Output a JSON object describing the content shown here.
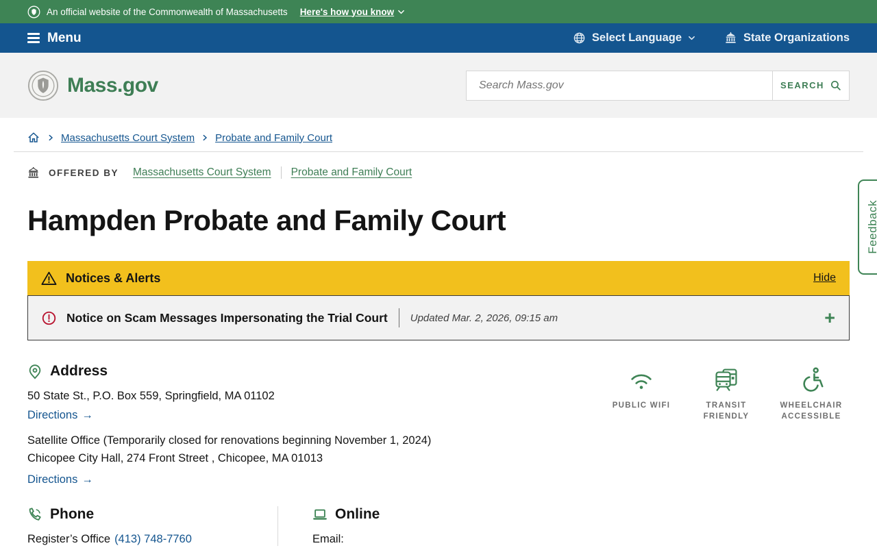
{
  "banner": {
    "text": "An official website of the Commonwealth of Massachusetts",
    "how_you_know": "Here's how you know"
  },
  "nav": {
    "menu_label": "Menu",
    "select_language": "Select Language",
    "state_organizations": "State Organizations"
  },
  "header": {
    "logo_text": "Mass.gov",
    "search_placeholder": "Search Mass.gov",
    "search_button": "SEARCH"
  },
  "breadcrumb": {
    "items": [
      "Massachusetts Court System",
      "Probate and Family Court"
    ]
  },
  "offered_by": {
    "label": "OFFERED BY",
    "links": [
      "Massachusetts Court System",
      "Probate and Family Court"
    ]
  },
  "page_title": "Hampden Probate and Family Court",
  "alerts": {
    "header": "Notices & Alerts",
    "hide_label": "Hide",
    "notice_title": "Notice on Scam Messages Impersonating the Trial Court",
    "notice_updated": "Updated Mar. 2, 2026, 09:15 am",
    "expand_symbol": "+"
  },
  "address": {
    "heading": "Address",
    "main_address": "50 State St., P.O. Box 559, Springfield, MA 01102",
    "directions_label": "Directions",
    "directions_arrow": "→",
    "satellite_title": "Satellite Office (Temporarily closed for renovations beginning November 1, 2024)",
    "satellite_address": "Chicopee City Hall, 274 Front Street , Chicopee, MA 01013"
  },
  "amenities": [
    {
      "name": "public-wifi",
      "label": "PUBLIC WIFI"
    },
    {
      "name": "transit-friendly",
      "label": "TRANSIT FRIENDLY"
    },
    {
      "name": "wheelchair-accessible",
      "label": "WHEELCHAIR ACCESSIBLE"
    }
  ],
  "phone": {
    "heading": "Phone",
    "office_label": "Register’s Office",
    "number": "(413) 748-7760"
  },
  "online": {
    "heading": "Online",
    "email_label": "Email:"
  },
  "feedback_tab": "Feedback",
  "colors": {
    "banner_green": "#3e8455",
    "nav_blue": "#14558f",
    "link_blue": "#14558f",
    "brand_green": "#3e7e55",
    "alert_yellow": "#f2c01d",
    "alert_red": "#b8122e",
    "text_dark": "#141414"
  }
}
